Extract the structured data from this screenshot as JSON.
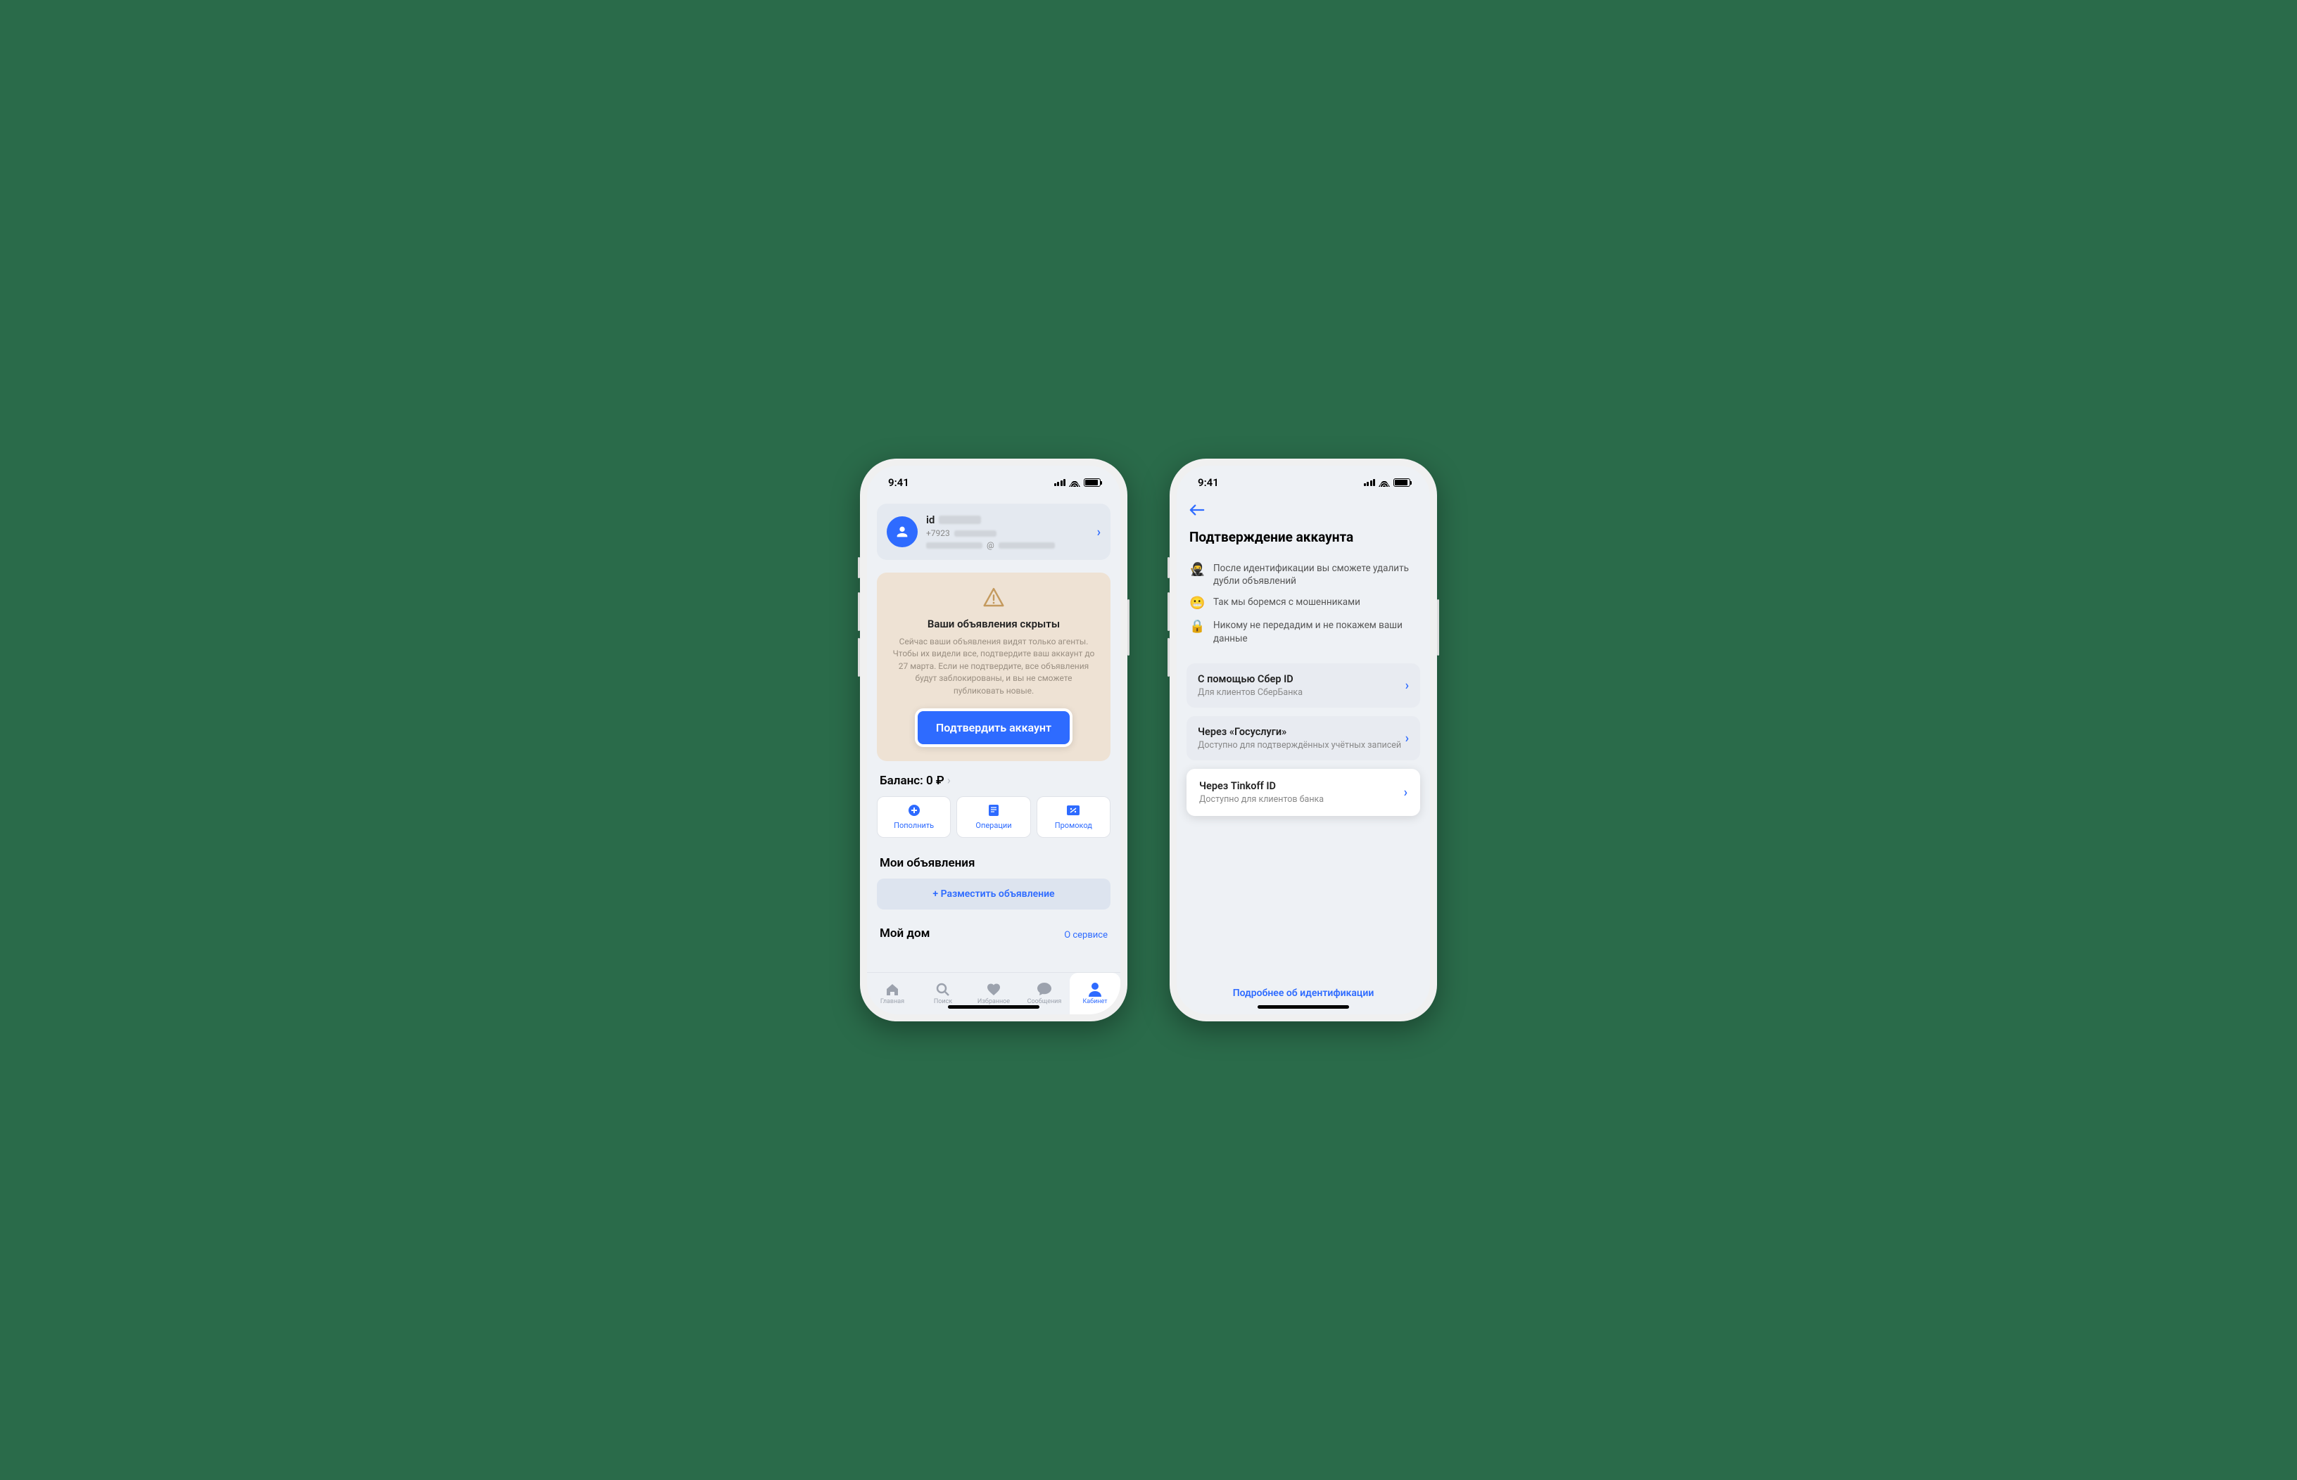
{
  "status": {
    "time": "9:41"
  },
  "profile": {
    "id_prefix": "id",
    "phone_prefix": "+7923",
    "email_at": "@"
  },
  "warn": {
    "title": "Ваши объявления скрыты",
    "body": "Сейчас ваши объявления видят только агенты. Чтобы их видели все, подтвердите ваш аккаунт до 27 марта.\nЕсли не подтвердите, все объявления будут заблокированы, и вы не сможете публиковать новые.",
    "cta": "Подтвердить аккаунт"
  },
  "balance": {
    "label": "Баланс: 0 ₽"
  },
  "actions": [
    {
      "label": "Пополнить"
    },
    {
      "label": "Операции"
    },
    {
      "label": "Промокод"
    }
  ],
  "listings": {
    "title": "Мои объявления",
    "add": "+ Разместить объявление"
  },
  "home": {
    "title": "Мой дом",
    "link": "О сервисе"
  },
  "tabs": [
    {
      "label": "Главная"
    },
    {
      "label": "Поиск"
    },
    {
      "label": "Избранное"
    },
    {
      "label": "Сообщения"
    },
    {
      "label": "Кабинет"
    }
  ],
  "verify": {
    "title": "Подтверждение аккаунта",
    "features": [
      {
        "emoji": "🥷",
        "text": "После идентификации вы сможете удалить дубли объявлений"
      },
      {
        "emoji": "😬",
        "text": "Так мы боремся с мошенниками"
      },
      {
        "emoji": "🔒",
        "text": "Никому не передадим и не покажем ваши данные"
      }
    ],
    "options": [
      {
        "title": "С помощью Сбер ID",
        "sub": "Для клиентов СберБанка"
      },
      {
        "title": "Через «Госуслуги»",
        "sub": "Доступно для подтверждённых учётных записей"
      },
      {
        "title": "Через Tinkoff ID",
        "sub": "Доступно для клиентов банка"
      }
    ],
    "more": "Подробнее об идентификации"
  }
}
